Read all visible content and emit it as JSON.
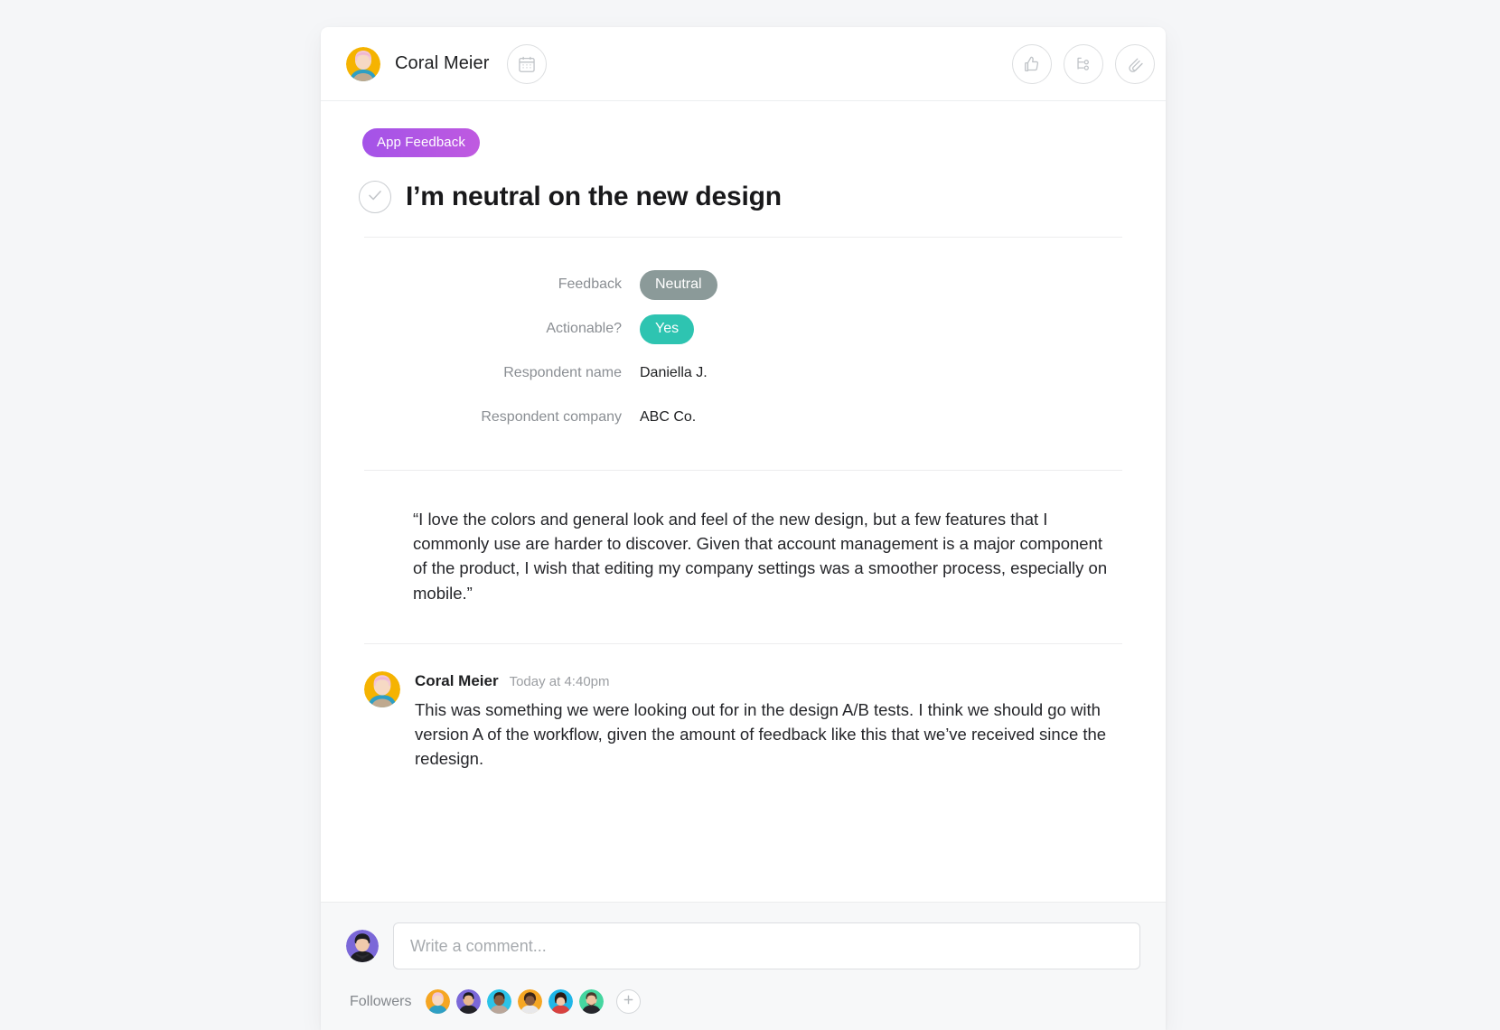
{
  "header": {
    "assignee_name": "Coral Meier",
    "due_date_icon": "calendar-icon",
    "actions": [
      {
        "icon": "thumbs-up-icon",
        "name": "like-button"
      },
      {
        "icon": "subtask-icon",
        "name": "subtask-button"
      },
      {
        "icon": "paperclip-icon",
        "name": "attachment-button"
      }
    ]
  },
  "task": {
    "tag": "App Feedback",
    "tag_color": "#b055e4",
    "title": "I’m neutral on the new design",
    "complete_icon": "check-circle-icon",
    "fields": [
      {
        "label": "Feedback",
        "value": "Neutral",
        "type": "pill",
        "color": "#8b9a99"
      },
      {
        "label": "Actionable?",
        "value": "Yes",
        "type": "pill",
        "color": "#2ec4b1"
      },
      {
        "label": "Respondent name",
        "value": "Daniella J.",
        "type": "text"
      },
      {
        "label": "Respondent company",
        "value": "ABC Co.",
        "type": "text"
      }
    ],
    "description": "“I love the colors and general look and feel of the new design, but a few features that I commonly use are harder to discover. Given that account management is a major component of the product, I wish that editing my company settings was a smoother process, especially on mobile.”"
  },
  "comments": [
    {
      "author": "Coral Meier",
      "time": "Today at 4:40pm",
      "body": "This was something we were looking out for in the design A/B tests. I think we should go with version A of the workflow, given the amount of feedback like this that we’ve received since the redesign."
    }
  ],
  "footer": {
    "compose_placeholder": "Write a comment...",
    "compose_value": "",
    "followers_label": "Followers",
    "followers": [
      {
        "name": "follower-1",
        "bg": "#f5a623"
      },
      {
        "name": "follower-2",
        "bg": "#7b68d8"
      },
      {
        "name": "follower-3",
        "bg": "#2bc3e8"
      },
      {
        "name": "follower-4",
        "bg": "#f5a623"
      },
      {
        "name": "follower-5",
        "bg": "#1fb6e8"
      },
      {
        "name": "follower-6",
        "bg": "#45d6a0"
      }
    ],
    "add_follower_icon": "plus-icon"
  }
}
